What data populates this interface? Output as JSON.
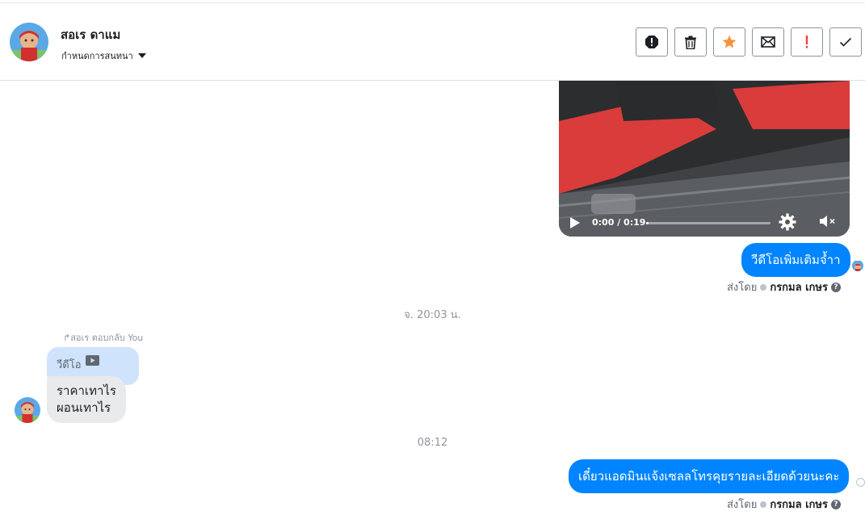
{
  "contact": {
    "name": "สอเร ดาแม",
    "assign_label": "กำหนดการสนทนา"
  },
  "toolbar": {
    "buttons": [
      {
        "name": "spam-button",
        "icon": "alert-octagon-icon"
      },
      {
        "name": "delete-button",
        "icon": "trash-icon"
      },
      {
        "name": "star-button",
        "icon": "star-icon",
        "color": "#f7923b"
      },
      {
        "name": "mark-unread-button",
        "icon": "envelope-icon"
      },
      {
        "name": "follow-up-button",
        "icon": "exclamation-icon",
        "color": "#fa3e3e"
      },
      {
        "name": "done-button",
        "icon": "checkmark-icon"
      }
    ]
  },
  "video": {
    "time": "0:00 / 0:19",
    "progress": 0.02
  },
  "messages": {
    "out1": "วีดีโอเพิ่มเติมจ้ำา",
    "sent_by_label": "ส่งโดย",
    "sent_by_name": "กรกมล เกษร",
    "ts1": "จ. 20:03 น.",
    "reply_note": "↱สอเร ตอบกลับ You",
    "reply_quote": "วีดีโอ",
    "in_line1": "ราคาเทาไร",
    "in_line2": "ผอนเทาไร",
    "ts2": "08:12",
    "out2": "เดี๋ยวแอดมินแจ้งเซลลโทรคุยรายละเอียดด้วยนะคะ",
    "sent_by_label2": "ส่งโดย",
    "sent_by_name2": "กรกมล เกษร"
  },
  "colors": {
    "outgoing_bubble": "#0084ff",
    "incoming_bubble": "#e9eaeb",
    "reply_bubble": "#cfe4fc"
  }
}
